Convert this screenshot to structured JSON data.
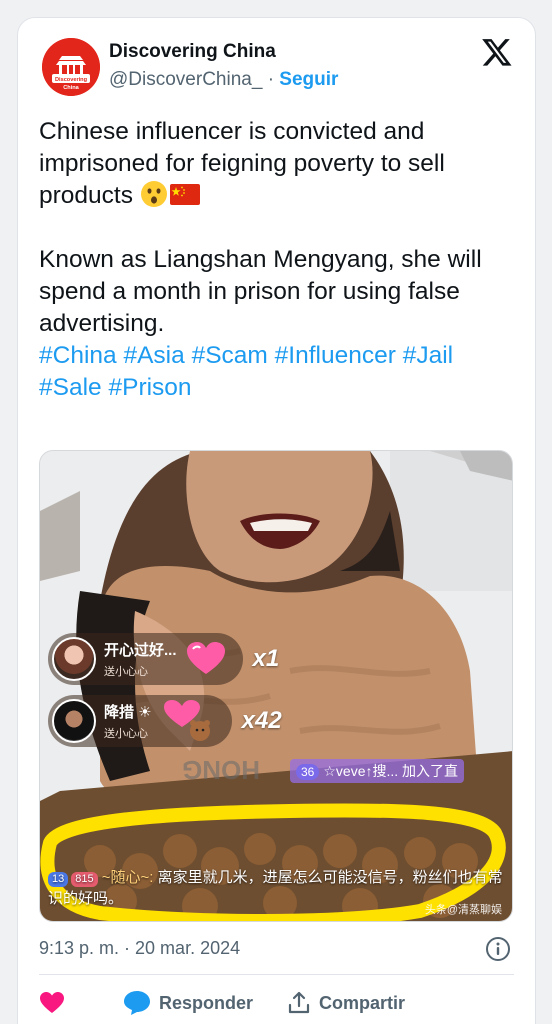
{
  "author": {
    "display_name": "Discovering China",
    "handle": "@DiscoverChina_",
    "separator": "·",
    "follow_label": "Seguir",
    "avatar_text": "Discovering China",
    "avatar_small_text": "发现中国"
  },
  "tweet": {
    "line1": "Chinese influencer is convicted and imprisoned for feigning poverty to sell products",
    "line2": "Known as Liangshan Mengyang, she will spend a month in prison for using false advertising.",
    "hashtags": [
      "#China",
      "#Asia",
      "#Scam",
      "#Influencer",
      "#Jail",
      "#Sale",
      "#Prison"
    ],
    "emojis": [
      "astonished-face-emoji",
      "china-flag-emoji"
    ]
  },
  "media": {
    "gifts": [
      {
        "name": "开心过好...",
        "sub": "送小心心",
        "count": "x1"
      },
      {
        "name": "降措 ☀",
        "sub": "送小心心",
        "count": "x42"
      }
    ],
    "join_notice": {
      "level": "36",
      "text": "☆veve↑搜... 加入了直"
    },
    "comment": {
      "badge_level": "13",
      "badge_heart": "815",
      "user": "~随心~:",
      "text": "离家里就几米，进屋怎么可能没信号，粉丝们也有常识的好吗。"
    },
    "watermark": "头条@清蒸聊娱",
    "sign_text": "HONG"
  },
  "meta": {
    "timestamp": "9:13 p. m. · 20 mar. 2024"
  },
  "actions": {
    "reply_label": "Responder",
    "share_label": "Compartir"
  },
  "colors": {
    "link": "#1d9bf0",
    "like": "#f91880",
    "text": "#0f1419",
    "muted": "#536471",
    "highlight": "#ffe100"
  }
}
